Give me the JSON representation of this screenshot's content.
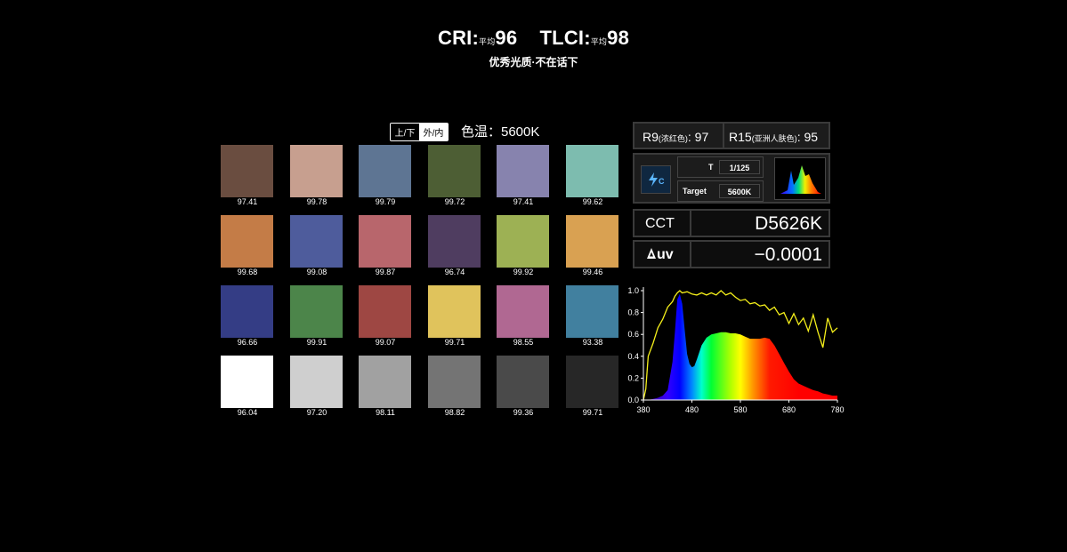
{
  "header": {
    "cri_label": "CRI:",
    "avg_label": "平均",
    "cri_value": "96",
    "tlci_label": "TLCI:",
    "tlci_value": "98",
    "tagline": "优秀光质·不在话下"
  },
  "toggle": {
    "option1": "上/下",
    "option2": "外/内"
  },
  "color_temp_label": "色温：5600K",
  "checker": {
    "swatches": [
      {
        "color": "#6a4d40",
        "value": "97.41"
      },
      {
        "color": "#c79f8f",
        "value": "99.78"
      },
      {
        "color": "#5e7593",
        "value": "99.79"
      },
      {
        "color": "#4d5e34",
        "value": "99.72"
      },
      {
        "color": "#8783ae",
        "value": "97.41"
      },
      {
        "color": "#7dbcaf",
        "value": "99.62"
      },
      {
        "color": "#c47c47",
        "value": "99.68"
      },
      {
        "color": "#4e5c9c",
        "value": "99.08"
      },
      {
        "color": "#b8666c",
        "value": "99.87"
      },
      {
        "color": "#4f3d60",
        "value": "96.74"
      },
      {
        "color": "#9db154",
        "value": "99.92"
      },
      {
        "color": "#d9a152",
        "value": "99.46"
      },
      {
        "color": "#343d85",
        "value": "96.66"
      },
      {
        "color": "#4c854a",
        "value": "99.91"
      },
      {
        "color": "#9e4743",
        "value": "99.07"
      },
      {
        "color": "#e0c35c",
        "value": "99.71"
      },
      {
        "color": "#b06892",
        "value": "98.55"
      },
      {
        "color": "#41809f",
        "value": "93.38"
      },
      {
        "color": "#ffffff",
        "value": "96.04"
      },
      {
        "color": "#cfcfcf",
        "value": "97.20"
      },
      {
        "color": "#a1a1a1",
        "value": "98.11"
      },
      {
        "color": "#747474",
        "value": "98.82"
      },
      {
        "color": "#4a4a4a",
        "value": "99.36"
      },
      {
        "color": "#272727",
        "value": "99.71"
      }
    ]
  },
  "meter": {
    "r9_label": "R9",
    "r9_sub": "(浓红色)",
    "r9_value": ": 97",
    "r15_label": "R15",
    "r15_sub": "(亚洲人肤色)",
    "r15_value": ": 95",
    "t_label": "T",
    "t_value": "1/125",
    "target_label": "Target",
    "target_value": "5600K",
    "cct_label": "CCT",
    "cct_value": "D5626K",
    "duv_label": "uv",
    "duv_value": "−0.0001"
  },
  "chart_data": {
    "type": "area",
    "title": "",
    "xlabel": "",
    "ylabel": "",
    "xlim": [
      380,
      780
    ],
    "ylim": [
      0,
      1.0
    ],
    "x_ticks": [
      "380",
      "480",
      "580",
      "680",
      "780"
    ],
    "y_ticks": [
      "0.0",
      "0.2",
      "0.4",
      "0.6",
      "0.8",
      "1.0"
    ],
    "grid": false,
    "series": [
      {
        "name": "",
        "x": [
          380,
          390,
          400,
          410,
          420,
          430,
          440,
          445,
          450,
          455,
          460,
          465,
          470,
          475,
          480,
          485,
          490,
          500,
          510,
          520,
          530,
          540,
          550,
          560,
          570,
          580,
          590,
          600,
          610,
          620,
          630,
          640,
          650,
          660,
          670,
          680,
          690,
          700,
          710,
          720,
          730,
          740,
          750,
          760,
          770,
          780
        ],
        "values": [
          0.0,
          0.0,
          0.01,
          0.02,
          0.04,
          0.09,
          0.35,
          0.62,
          0.92,
          0.97,
          0.88,
          0.65,
          0.42,
          0.33,
          0.3,
          0.31,
          0.37,
          0.5,
          0.57,
          0.6,
          0.61,
          0.62,
          0.62,
          0.61,
          0.61,
          0.6,
          0.58,
          0.56,
          0.56,
          0.56,
          0.57,
          0.56,
          0.5,
          0.42,
          0.34,
          0.26,
          0.19,
          0.15,
          0.13,
          0.11,
          0.09,
          0.08,
          0.06,
          0.05,
          0.04,
          0.04
        ]
      },
      {
        "name": "",
        "x": [
          380,
          385,
          390,
          400,
          410,
          420,
          430,
          440,
          445,
          450,
          455,
          460,
          470,
          480,
          490,
          500,
          510,
          520,
          530,
          540,
          550,
          560,
          570,
          580,
          590,
          600,
          610,
          620,
          630,
          640,
          650,
          660,
          670,
          680,
          690,
          700,
          710,
          720,
          730,
          740,
          750,
          760,
          770,
          780
        ],
        "values": [
          0.0,
          0.1,
          0.4,
          0.52,
          0.66,
          0.74,
          0.85,
          0.9,
          0.95,
          0.98,
          1.0,
          0.98,
          0.99,
          0.97,
          0.96,
          0.98,
          0.96,
          0.98,
          0.96,
          1.0,
          0.96,
          0.98,
          0.94,
          0.91,
          0.92,
          0.88,
          0.89,
          0.86,
          0.87,
          0.82,
          0.85,
          0.78,
          0.8,
          0.7,
          0.79,
          0.69,
          0.75,
          0.63,
          0.78,
          0.62,
          0.48,
          0.75,
          0.62,
          0.66
        ]
      }
    ]
  }
}
